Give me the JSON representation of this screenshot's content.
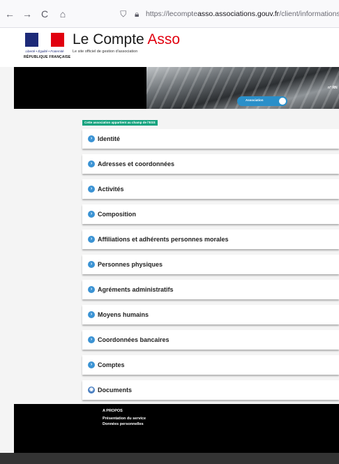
{
  "browser": {
    "back_icon": "←",
    "forward_icon": "→",
    "reload_icon": "C",
    "home_icon": "⌂",
    "url_prefix": "https://lecompte",
    "url_domain": "asso.associations.gouv.fr",
    "url_path": "/client/informations-a"
  },
  "header": {
    "motto": "Liberté • Égalité • Fraternité",
    "republique": "RÉPUBLIQUE FRANÇAISE",
    "brand_main": "Le Compte ",
    "brand_accent": "Asso",
    "subtitle": "Le site officiel de gestion d'association"
  },
  "banner": {
    "toggle_label": "Association",
    "number_label": "n° RN"
  },
  "main": {
    "champ_badge": "Cette association appartient au champ de l'ESS",
    "sections": [
      {
        "label": "Identité"
      },
      {
        "label": "Adresses et coordonnées"
      },
      {
        "label": "Activités"
      },
      {
        "label": "Composition"
      },
      {
        "label": "Affiliations et adhérents personnes morales"
      },
      {
        "label": "Personnes physiques"
      },
      {
        "label": "Agréments administratifs"
      },
      {
        "label": "Moyens humains"
      },
      {
        "label": "Coordonnées bancaires"
      },
      {
        "label": "Comptes"
      },
      {
        "label": "Documents"
      }
    ]
  },
  "footer": {
    "title": "A PROPOS",
    "links": [
      "Présentation du service",
      "Données personnelles"
    ]
  },
  "colors": {
    "accent_red": "#e1000f",
    "section_icon_blue": "#3b93d4",
    "badge_green": "#14a37f",
    "toggle_blue": "#2a8fc9"
  }
}
